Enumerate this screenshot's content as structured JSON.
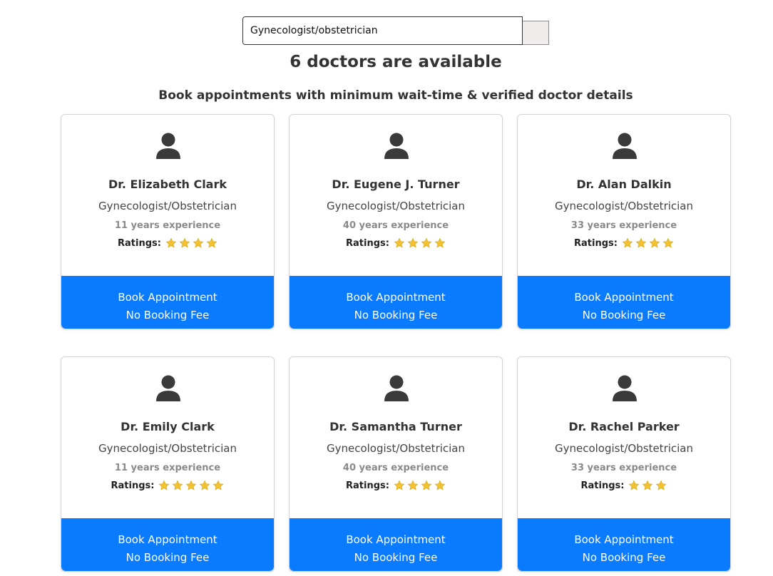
{
  "search": {
    "value": "Gynecologist/obstetrician"
  },
  "heading": {
    "count_text": "6 doctors are available",
    "subtitle": "Book appointments with minimum wait-time & verified doctor details"
  },
  "colors": {
    "button_blue": "#0a7bff",
    "star_gold": "#f2c230",
    "avatar_gray": "#3a3a3a"
  },
  "ratings_label": "Ratings:",
  "doctors": [
    {
      "name": "Dr. Elizabeth Clark",
      "specialty": "Gynecologist/Obstetrician",
      "experience": "11 years experience",
      "stars": 4,
      "button_line1": "Book Appointment",
      "button_line2": "No Booking Fee"
    },
    {
      "name": "Dr. Eugene J. Turner",
      "specialty": "Gynecologist/Obstetrician",
      "experience": "40 years experience",
      "stars": 4,
      "button_line1": "Book Appointment",
      "button_line2": "No Booking Fee"
    },
    {
      "name": "Dr. Alan Dalkin",
      "specialty": "Gynecologist/Obstetrician",
      "experience": "33 years experience",
      "stars": 4,
      "button_line1": "Book Appointment",
      "button_line2": "No Booking Fee"
    },
    {
      "name": "Dr. Emily Clark",
      "specialty": "Gynecologist/Obstetrician",
      "experience": "11 years experience",
      "stars": 5,
      "button_line1": "Book Appointment",
      "button_line2": "No Booking Fee"
    },
    {
      "name": "Dr. Samantha Turner",
      "specialty": "Gynecologist/Obstetrician",
      "experience": "40 years experience",
      "stars": 4,
      "button_line1": "Book Appointment",
      "button_line2": "No Booking Fee"
    },
    {
      "name": "Dr. Rachel Parker",
      "specialty": "Gynecologist/Obstetrician",
      "experience": "33 years experience",
      "stars": 3,
      "button_line1": "Book Appointment",
      "button_line2": "No Booking Fee"
    }
  ]
}
